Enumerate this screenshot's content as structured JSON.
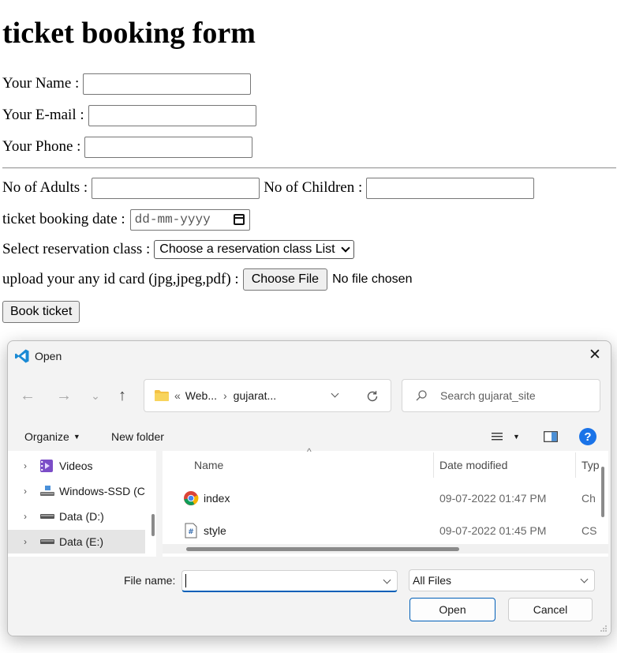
{
  "form": {
    "title": "ticket booking form",
    "name_label": "Your Name :",
    "email_label": "Your E-mail :",
    "phone_label": "Your Phone :",
    "adults_label": "No of Adults :",
    "children_label": "No of Children :",
    "date_label": "ticket booking date :",
    "date_placeholder": "dd-mm-yyyy",
    "class_label": "Select reservation class :",
    "class_selected": "Choose a reservation class List",
    "upload_label": "upload your any id card (jpg,jpeg,pdf) :",
    "choose_file": "Choose File",
    "no_file": "No file chosen",
    "book_button": "Book ticket"
  },
  "dialog": {
    "title": "Open",
    "close_symbol": "✕",
    "breadcrumb": {
      "prefix": "«",
      "segments": [
        "Web...",
        "gujarat..."
      ],
      "separator": "›"
    },
    "search_placeholder": "Search gujarat_site",
    "toolbar": {
      "organize": "Organize",
      "new_folder": "New folder",
      "help": "?"
    },
    "sidebar": [
      {
        "label": "Videos",
        "icon": "videos-folder-icon"
      },
      {
        "label": "Windows-SSD (C",
        "icon": "drive-icon"
      },
      {
        "label": "Data (D:)",
        "icon": "drive-icon"
      },
      {
        "label": "Data (E:)",
        "icon": "drive-icon",
        "selected": true
      }
    ],
    "columns": {
      "name": "Name",
      "date": "Date modified",
      "type": "Typ"
    },
    "files": [
      {
        "name": "index",
        "date": "09-07-2022 01:47 PM",
        "type": "Ch",
        "icon": "chrome-icon"
      },
      {
        "name": "style",
        "date": "09-07-2022 01:45 PM",
        "type": "CS",
        "icon": "css-file-icon"
      }
    ],
    "filename_label": "File name:",
    "filename_value": "",
    "filetype": "All Files",
    "open_button": "Open",
    "cancel_button": "Cancel"
  },
  "colors": {
    "accent": "#005fb8",
    "help_blue": "#1a73e8",
    "vscode_blue": "#1a8ad4",
    "folder_yellow": "#f4c244"
  }
}
